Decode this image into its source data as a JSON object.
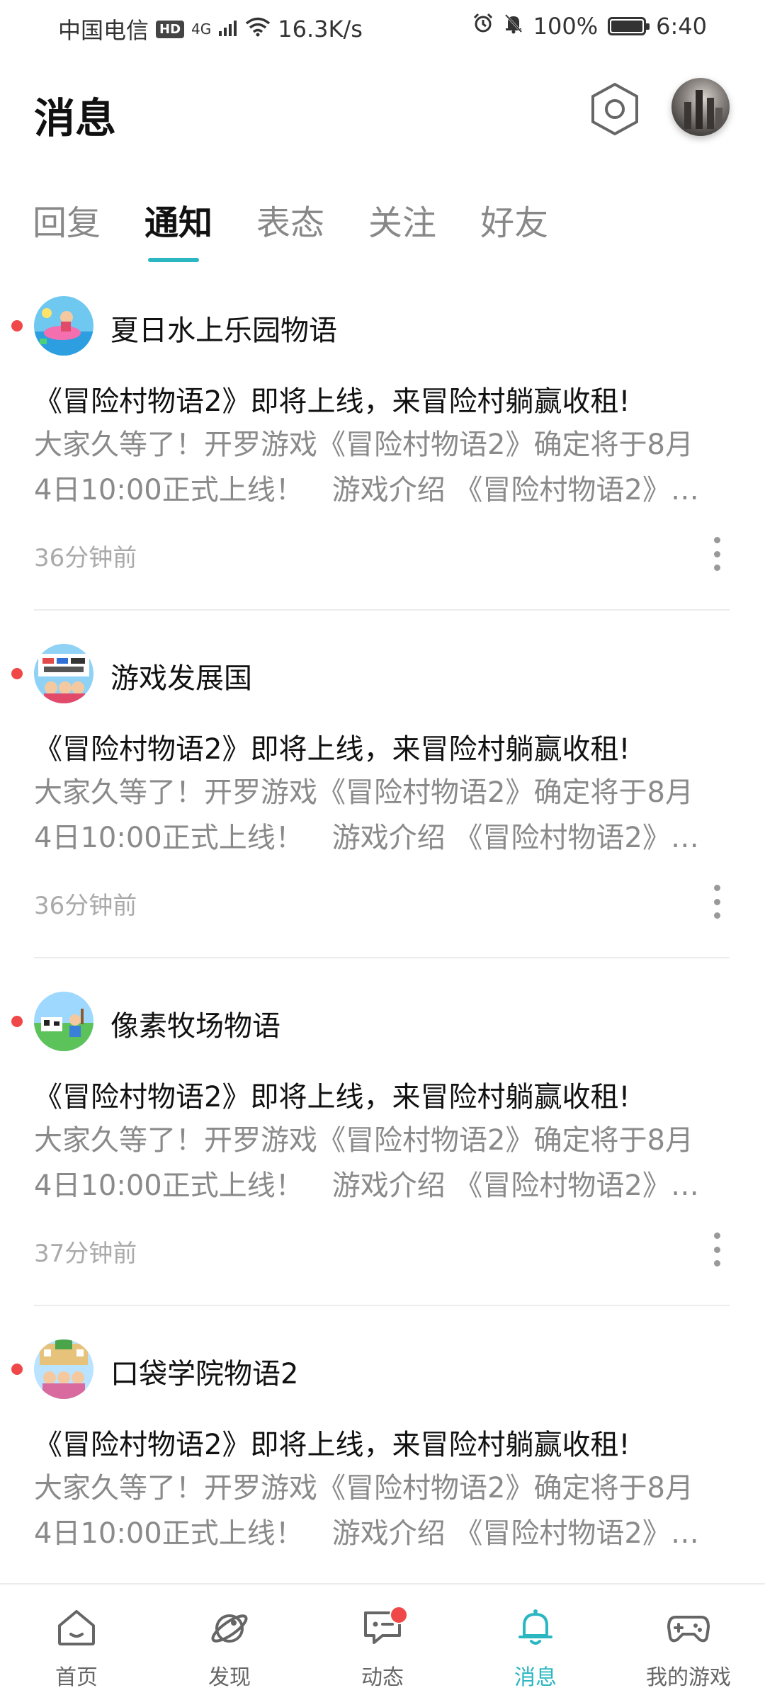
{
  "status_bar": {
    "carrier": "中国电信",
    "hd": "HD",
    "network": "4G",
    "speed": "16.3K/s",
    "battery": "100%",
    "battery_level": 1.0,
    "time": "6:40"
  },
  "header": {
    "title": "消息"
  },
  "tabs": [
    {
      "label": "回复",
      "active": false
    },
    {
      "label": "通知",
      "active": true
    },
    {
      "label": "表态",
      "active": false
    },
    {
      "label": "关注",
      "active": false
    },
    {
      "label": "好友",
      "active": false
    }
  ],
  "notifications": [
    {
      "game": "夏日水上乐园物语",
      "headline": "《冒险村物语2》即将上线，来冒险村躺赢收租!",
      "summary_line1": "大家久等了！开罗游戏《冒险村物语2》确定将于8月",
      "summary_line2": "4日10:00正式上线！　游戏介绍 《冒险村物语2》…",
      "time": "36分钟前",
      "unread": true
    },
    {
      "game": "游戏发展国",
      "headline": "《冒险村物语2》即将上线，来冒险村躺赢收租!",
      "summary_line1": "大家久等了！开罗游戏《冒险村物语2》确定将于8月",
      "summary_line2": "4日10:00正式上线！　游戏介绍 《冒险村物语2》…",
      "time": "36分钟前",
      "unread": true
    },
    {
      "game": "像素牧场物语",
      "headline": "《冒险村物语2》即将上线，来冒险村躺赢收租!",
      "summary_line1": "大家久等了！开罗游戏《冒险村物语2》确定将于8月",
      "summary_line2": "4日10:00正式上线！　游戏介绍 《冒险村物语2》…",
      "time": "37分钟前",
      "unread": true
    },
    {
      "game": "口袋学院物语2",
      "headline": "《冒险村物语2》即将上线，来冒险村躺赢收租!",
      "summary_line1": "大家久等了！开罗游戏《冒险村物语2》确定将于8月",
      "summary_line2": "4日10:00正式上线！　游戏介绍 《冒险村物语2》…",
      "time": "",
      "unread": true
    }
  ],
  "bottom_nav": [
    {
      "label": "首页",
      "icon": "home-icon",
      "active": false
    },
    {
      "label": "发现",
      "icon": "planet-icon",
      "active": false
    },
    {
      "label": "动态",
      "icon": "chat-icon",
      "active": false,
      "badge": true
    },
    {
      "label": "消息",
      "icon": "bell-icon",
      "active": true
    },
    {
      "label": "我的游戏",
      "icon": "gamepad-icon",
      "active": false
    }
  ],
  "colors": {
    "accent": "#2bb7c1",
    "unread_dot": "#f04848",
    "muted_text": "#8a8a8a"
  }
}
